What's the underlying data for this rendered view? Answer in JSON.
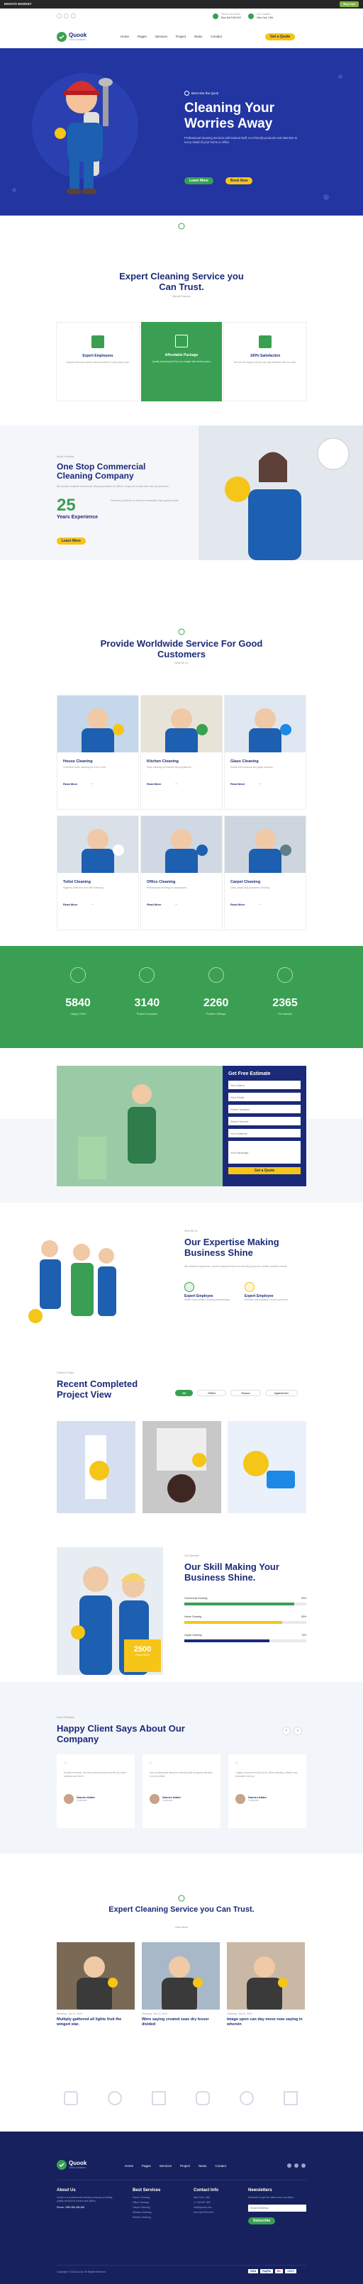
{
  "topbar": {
    "brand": "ENVATO MARKET",
    "buy": "Buy now"
  },
  "header": {
    "logo_name": "Quook",
    "logo_tag": "Clean Solutions",
    "hours_label": "Phone Line Hours",
    "hours_value": "Mon-Sat 9:00-6:00",
    "address_label": "Our Location",
    "address_value": "New York, USA",
    "cta": "Get a Quote",
    "nav": [
      "Home",
      "Pages",
      "Services",
      "Project",
      "News",
      "Contact"
    ]
  },
  "hero": {
    "kicker": "Best Hire the Quok",
    "title": "Cleaning Your Worries Away",
    "text": "Professional cleaning services with trained staff, eco-friendly products and attention to every detail of your home or office.",
    "btn1": "Learn More",
    "btn2": "Book Now"
  },
  "expert": {
    "title": "Expert Cleaning Service you Can Trust.",
    "sub": "Special Features",
    "cards": [
      {
        "title": "Expert Employees",
        "text": "Experienced and trained cleaning staff for every kind of job."
      },
      {
        "title": "Affordable Package",
        "text": "Quality cleaning that fits your budget with flexible plans."
      },
      {
        "title": "100% Satisfaction",
        "text": "We are not happy until you are fully satisfied with our work."
      }
    ]
  },
  "commercial": {
    "kicker": "About Company",
    "title": "One Stop Commercial Cleaning Company",
    "text": "We provide complete commercial cleaning solutions for offices, shops and homes with care and precision.",
    "years": "25",
    "years_label": "Years Experience",
    "years_text": "Trusted by hundreds of clients for consistent, high quality results.",
    "btn": "Learn More"
  },
  "services": {
    "title": "Provide Worldwide Service For Good Customers",
    "sub": "What We Do",
    "read": "Read More",
    "items": [
      {
        "title": "House Cleaning",
        "text": "Complete home cleaning for every room."
      },
      {
        "title": "Kitchen Cleaning",
        "text": "Deep cleaning of kitchens and appliances."
      },
      {
        "title": "Glass Cleaning",
        "text": "Streak free windows and glass surfaces."
      },
      {
        "title": "Toilet Cleaning",
        "text": "Hygienic bathroom and toilet cleaning."
      },
      {
        "title": "Office Cleaning",
        "text": "Professional cleaning for workspaces."
      },
      {
        "title": "Carpet Cleaning",
        "text": "Deep carpet and upholstery cleaning."
      }
    ]
  },
  "counters": [
    {
      "num": "5840",
      "label": "Happy Client"
    },
    {
      "num": "3140",
      "label": "Project Complete"
    },
    {
      "num": "2260",
      "label": "Positive Ratings"
    },
    {
      "num": "2365",
      "label": "Our Awards"
    }
  ],
  "estimate": {
    "title": "Get Free Estimate",
    "fields": [
      "Your Name",
      "Your Email",
      "Phone Number",
      "Select Service",
      "Your Address",
      "Your Message"
    ],
    "btn": "Get a Quote"
  },
  "expertise": {
    "kicker": "What We Do",
    "title": "Our Expertise Making Business Shine",
    "text": "We combine experience, modern equipment and eco-friendly products to deliver spotless results.",
    "items": [
      {
        "title": "Expert Employee",
        "text": "Skilled and certified cleaning professionals."
      },
      {
        "title": "Expert Employee",
        "text": "Reliable staff available on your schedule."
      }
    ]
  },
  "projects": {
    "kicker": "Finished Project",
    "title": "Recent Completed Project View",
    "filters": [
      "All",
      "Office",
      "House",
      "Apartment"
    ]
  },
  "skills": {
    "kicker": "Our Expertise",
    "title": "Our Skill Making Your Business Shine.",
    "badge": "2500",
    "badge_label": "Project Done",
    "bars": [
      {
        "label": "Commercial Cleaning",
        "pct": "90%",
        "val": 0.9,
        "color": "#3a9f52"
      },
      {
        "label": "House Cleaning",
        "pct": "80%",
        "val": 0.8,
        "color": "#f5c518"
      },
      {
        "label": "Carpet Cleaning",
        "pct": "70%",
        "val": 0.7,
        "color": "#1b2a78"
      }
    ]
  },
  "testimonials": {
    "kicker": "Client Feedback",
    "title": "Happy Client Says About Our Company",
    "items": [
      {
        "text": "Excellent service, the team was punctual and left my home spotless and fresh.",
        "name": "Saurou Adam",
        "role": "Customer"
      },
      {
        "text": "Very professional cleaners, friendly staff and great attention to every detail.",
        "name": "Saurou Adam",
        "role": "Customer"
      },
      {
        "text": "I highly recommend Quook for office cleaning, reliable and affordable service.",
        "name": "Saurou Adam",
        "role": "Customer"
      }
    ]
  },
  "blog": {
    "title": "Expert Cleaning Service you Can Trust.",
    "sub": "Latest News",
    "items": [
      {
        "meta": "Cleaning / Jan 12, 2023",
        "title": "Multiply gathered all lights fruit the winged star."
      },
      {
        "meta": "Cleaning / Jan 12, 2023",
        "title": "Were saying created seas dry lesser divided"
      },
      {
        "meta": "Cleaning / Jan 12, 2023",
        "title": "Image upon can day move now saying in wherein"
      }
    ]
  },
  "footer": {
    "logo_name": "Quook",
    "logo_tag": "Clean Solutions",
    "nav": [
      "Home",
      "Pages",
      "Services",
      "Project",
      "News",
      "Contact"
    ],
    "about_title": "About Us",
    "about_text": "Quook is a professional cleaning company providing quality service for homes and offices.",
    "phone": "Phone: +880 456 456 456",
    "services_title": "Best Services",
    "services": [
      "House Cleaning",
      "Office Cleaning",
      "Carpet Cleaning",
      "Window Cleaning",
      "Kitchen Cleaning"
    ],
    "contact_title": "Contact Info",
    "contact": [
      "New York, USA",
      "+1 234 567 890",
      "info@quook.com",
      "Mon-Sat 9:00-6:00"
    ],
    "news_title": "Newsletters",
    "news_text": "Subscribe to get the latest news and offers.",
    "news_placeholder": "Email Address",
    "news_btn": "Subscribe",
    "copyright": "Copyright © 2023 Quook. All Rights Reserved",
    "pay": [
      "VISA",
      "PayPal",
      "MC",
      "AMEX"
    ]
  }
}
